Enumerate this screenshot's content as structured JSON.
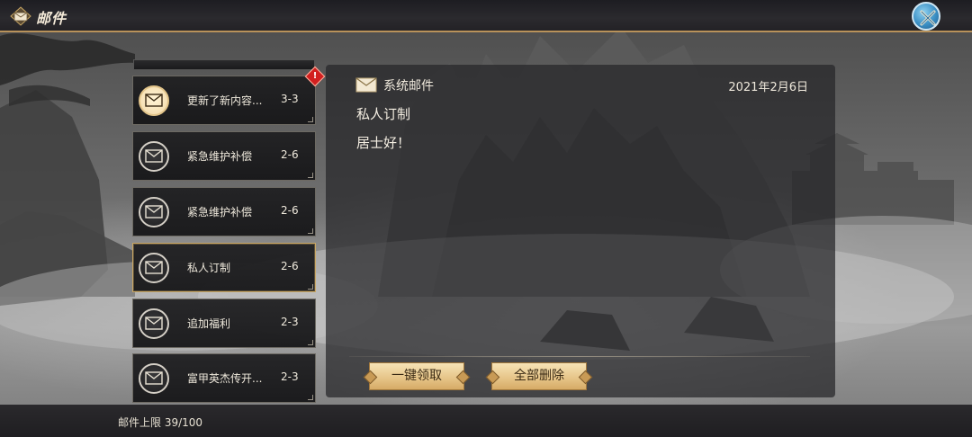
{
  "header": {
    "title": "邮件",
    "icon": "mail-icon",
    "close_icon": "close-x-icon"
  },
  "mail_list": [
    {
      "title": "更新了新内容...",
      "count": "3-3",
      "unread": true,
      "icon": "mail-icon"
    },
    {
      "title": "紧急维护补偿",
      "count": "2-6",
      "unread": false,
      "icon": "mail-icon"
    },
    {
      "title": "紧急维护补偿",
      "count": "2-6",
      "unread": false,
      "icon": "mail-icon"
    },
    {
      "title": "私人订制",
      "count": "2-6",
      "unread": false,
      "selected": true,
      "icon": "mail-icon"
    },
    {
      "title": "追加福利",
      "count": "2-3",
      "unread": false,
      "icon": "mail-icon"
    },
    {
      "title": "富甲英杰传开...",
      "count": "2-3",
      "unread": false,
      "icon": "mail-icon"
    }
  ],
  "new_badge": "!",
  "detail": {
    "sender": "系统邮件",
    "date": "2021年2月6日",
    "subject": "私人订制",
    "body": "居士好！",
    "claim_all_label": "一键领取",
    "delete_all_label": "全部删除"
  },
  "footer": {
    "capacity": "邮件上限 39/100"
  },
  "colors": {
    "accent_gold": "#e7c68a",
    "header_border": "#b8925a",
    "badge_red": "#d21f1f",
    "close_blue": "#3b8fc4"
  }
}
